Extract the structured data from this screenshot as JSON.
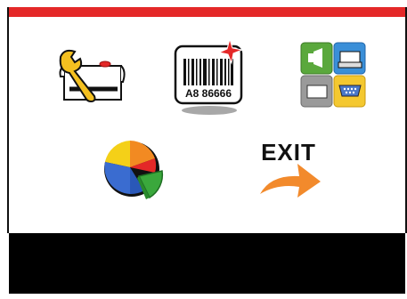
{
  "colors": {
    "top_bar": "#e42828",
    "bottom_bar": "#000000",
    "background": "#ffffff",
    "exit_arrow": "#f28a2c"
  },
  "menu": {
    "items": [
      {
        "id": "settings",
        "icon": "wrench-printer-icon"
      },
      {
        "id": "label",
        "icon": "barcode-label-icon",
        "barcode_text": "A8 86666"
      },
      {
        "id": "interface",
        "icon": "interface-ports-icon"
      },
      {
        "id": "statistics",
        "icon": "pie-chart-icon"
      },
      {
        "id": "exit",
        "icon": "exit-arrow-icon",
        "label": "EXIT"
      }
    ]
  }
}
